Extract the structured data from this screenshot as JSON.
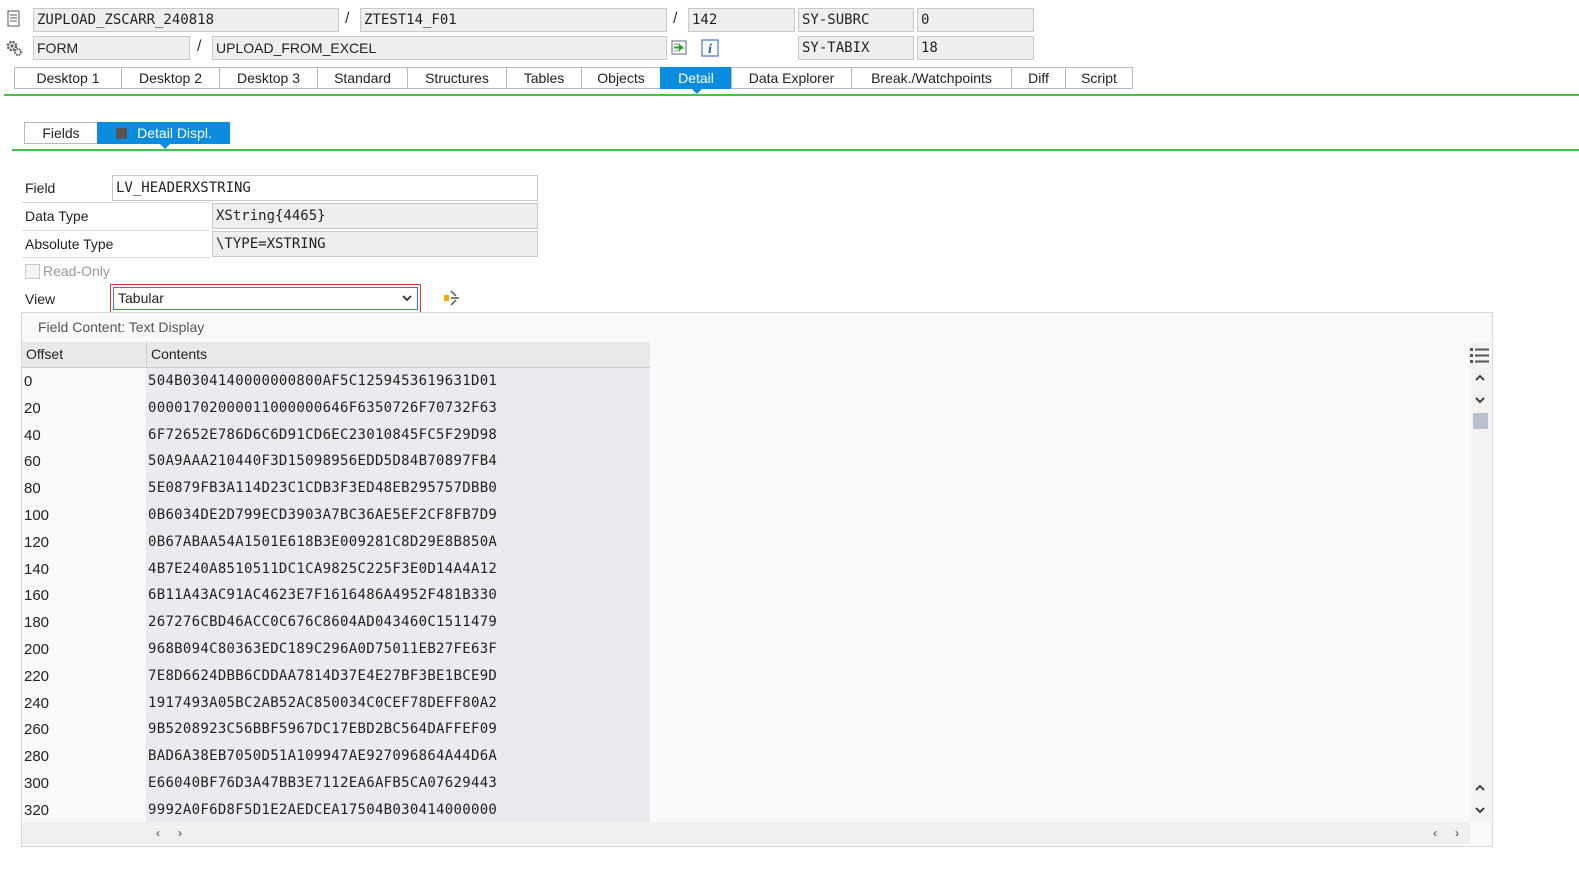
{
  "header": {
    "program": "ZUPLOAD_ZSCARR_240818",
    "include": "ZTEST14_F01",
    "line": "142",
    "sy_subrc_label": "SY-SUBRC",
    "sy_subrc_value": "0",
    "event_type": "FORM",
    "event_name": "UPLOAD_FROM_EXCEL",
    "sy_tabix_label": "SY-TABIX",
    "sy_tabix_value": "18",
    "separator": "/"
  },
  "tabs": [
    {
      "label": "Desktop 1"
    },
    {
      "label": "Desktop 2"
    },
    {
      "label": "Desktop 3"
    },
    {
      "label": "Standard"
    },
    {
      "label": "Structures"
    },
    {
      "label": "Tables"
    },
    {
      "label": "Objects"
    },
    {
      "label": "Detail",
      "active": true
    },
    {
      "label": "Data Explorer"
    },
    {
      "label": "Break./Watchpoints"
    },
    {
      "label": "Diff"
    },
    {
      "label": "Script"
    }
  ],
  "subtabs": {
    "fields": "Fields",
    "detail_displ": "Detail Displ."
  },
  "detail": {
    "field_label": "Field",
    "field_value": "LV_HEADERXSTRING",
    "data_type_label": "Data Type",
    "data_type_value": "XString{4465}",
    "absolute_type_label": "Absolute Type",
    "absolute_type_value": "\\TYPE=XSTRING",
    "read_only_label": "Read-Only",
    "view_label": "View",
    "view_value": "Tabular"
  },
  "content": {
    "title": "Field Content: Text Display",
    "col_offset": "Offset",
    "col_contents": "Contents",
    "rows": [
      {
        "offset": "0",
        "contents": "504B0304140000000800AF5C1259453619631D01"
      },
      {
        "offset": "20",
        "contents": "00001702000011000000646F6350726F70732F63"
      },
      {
        "offset": "40",
        "contents": "6F72652E786D6C6D91CD6EC23010845FC5F29D98"
      },
      {
        "offset": "60",
        "contents": "50A9AAA210440F3D15098956EDD5D84B70897FB4"
      },
      {
        "offset": "80",
        "contents": "5E0879FB3A114D23C1CDB3F3ED48EB295757DBB0"
      },
      {
        "offset": "100",
        "contents": "0B6034DE2D799ECD3903A7BC36AE5EF2CF8FB7D9"
      },
      {
        "offset": "120",
        "contents": "0B67ABAA54A1501E618B3E009281C8D29E8B850A"
      },
      {
        "offset": "140",
        "contents": "4B7E240A8510511DC1CA9825C225F3E0D14A4A12"
      },
      {
        "offset": "160",
        "contents": "6B11A43AC91AC4623E7F1616486A4952F481B330"
      },
      {
        "offset": "180",
        "contents": "267276CBD46ACC0C676C8604AD043460C1511479"
      },
      {
        "offset": "200",
        "contents": "968B094C80363EDC189C296A0D75011EB27FE63F"
      },
      {
        "offset": "220",
        "contents": "7E8D6624DBB6CDDAA7814D37E4E27BF3BE1BCE9D"
      },
      {
        "offset": "240",
        "contents": "1917493A05BC2AB52AC850034C0CEF78DEFF80A2"
      },
      {
        "offset": "260",
        "contents": "9B5208923C56BBF5967DC17EBD2BC564DAFFEF09"
      },
      {
        "offset": "280",
        "contents": "BAD6A38EB7050D51A109947AE927096864A44D6A"
      },
      {
        "offset": "300",
        "contents": "E66040BF76D3A47BB3E7112EA6AFB5CA07629443"
      },
      {
        "offset": "320",
        "contents": "9992A0F6D8F5D1E2AEDCEA17504B030414000000"
      }
    ]
  },
  "colors": {
    "accent": "#0a8de0",
    "green_line": "#3fc63f",
    "field_bg": "#efefef"
  }
}
